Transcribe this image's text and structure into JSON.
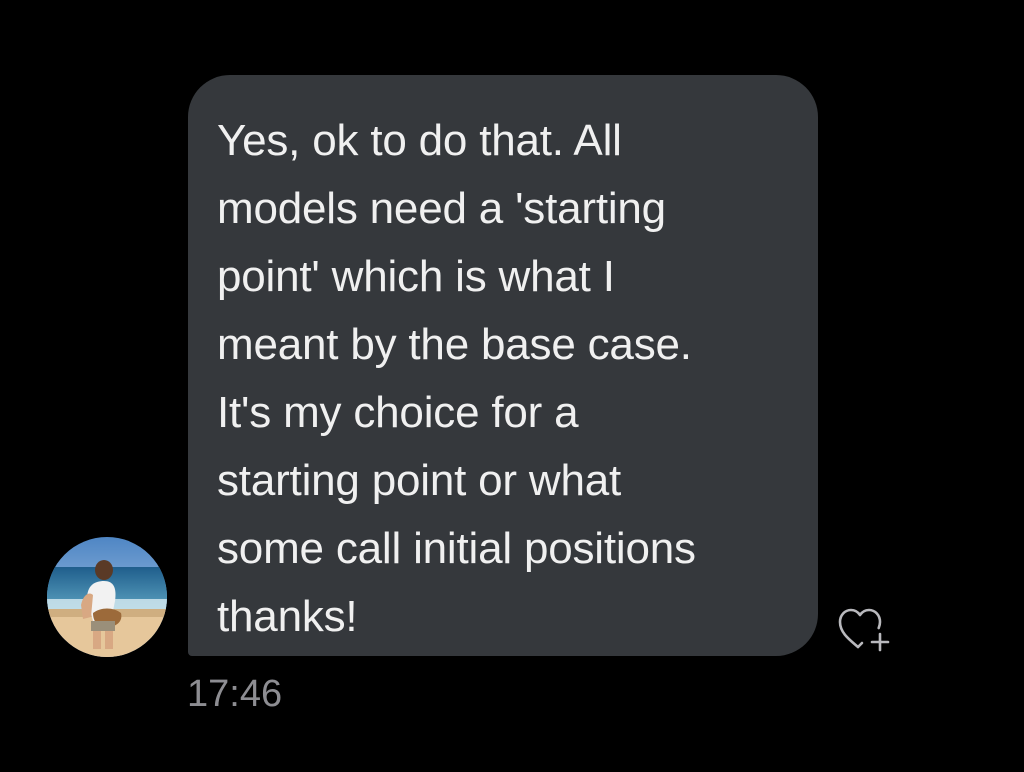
{
  "message": {
    "lines": [
      "Yes, ok to do that. All",
      "models need a 'starting",
      "point' which is what I",
      "meant by the base case.",
      "It's my choice for a",
      "starting point or what",
      "some call initial positions",
      "thanks!"
    ],
    "timestamp": "17:46",
    "bubble_color": "#35383c",
    "text_color": "#f0f0f0"
  },
  "reaction_button": {
    "icon": "heart-plus-icon"
  },
  "sender": {
    "avatar_icon": "avatar-photo"
  },
  "colors": {
    "background": "#000000",
    "timestamp": "#8d8d92"
  }
}
